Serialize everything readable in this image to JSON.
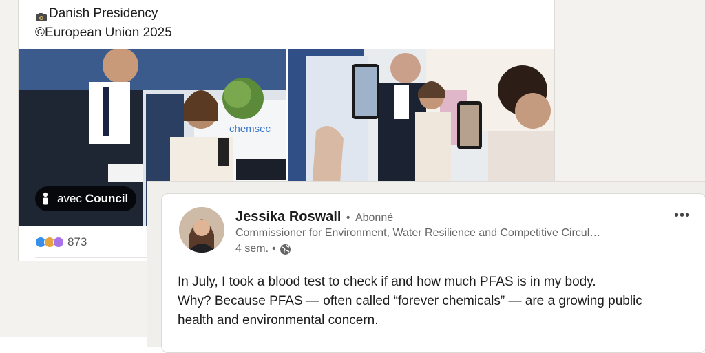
{
  "post": {
    "caption_line1": "Danish Presidency",
    "caption_line2": "©European Union 2025",
    "tag_prefix": "avec",
    "tag_name": "Council",
    "reaction_count": "873",
    "photo_sign_text": "chemsec"
  },
  "snippet": {
    "author_name": "Jessika Roswall",
    "author_separator": "•",
    "author_relation": "Abonné",
    "headline": "Commissioner for Environment, Water Resilience and Competitive Circul…",
    "time_ago": "4 sem.",
    "time_separator": "•",
    "more_label": "•••",
    "body": [
      "In July, I took a blood test to check if and how much PFAS is in my body.",
      "Why? Because PFAS — often called “forever chemicals” — are a growing public",
      "health and environmental concern."
    ]
  },
  "colors": {
    "badge_bg": "#000000",
    "muted_text": "#666666",
    "reaction_like": "#378fe9",
    "reaction_celebrate": "#e7a33e",
    "reaction_support": "#a872e8"
  },
  "icons": {
    "camera": "camera-icon",
    "person": "person-tag-icon",
    "globe": "globe-icon"
  }
}
